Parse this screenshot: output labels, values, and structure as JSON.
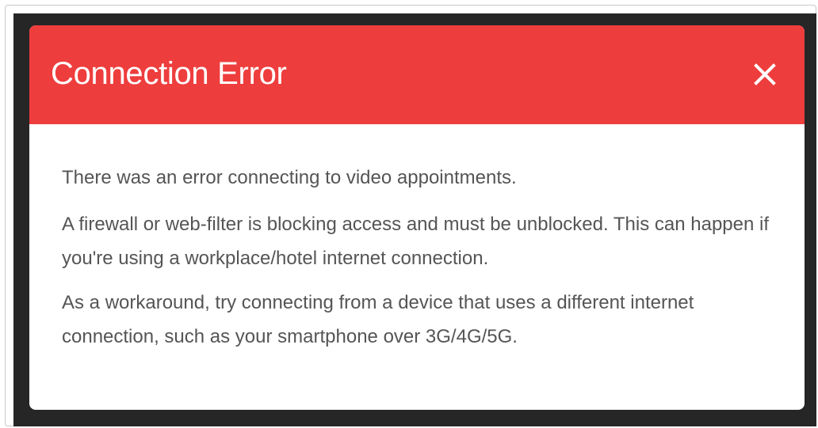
{
  "dialog": {
    "title": "Connection Error",
    "close_icon": "close-icon",
    "header_color": "#ee3d3d",
    "messages": [
      "There was an error connecting to video appointments.",
      "A firewall or web-filter is blocking access and must be unblocked. This can happen if you're using a workplace/hotel internet connection.",
      "As a workaround, try connecting from a device that uses a different internet connection, such as your smartphone over 3G/4G/5G."
    ]
  }
}
